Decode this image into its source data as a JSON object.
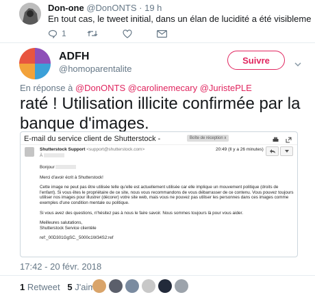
{
  "reply": {
    "name": "Don-one",
    "handle": "@DonONTS",
    "sep": "·",
    "time": "19 h",
    "text": "En tout cas, le tweet initial, dans un élan de lucidité a été visiblement supprimé....",
    "reply_count": "1"
  },
  "tweet": {
    "name": "ADFH",
    "handle": "@homoparentalite",
    "follow_label": "Suivre",
    "in_reply_prefix": "En réponse à",
    "mentions": [
      "@DonONTS",
      "@carolinemecary",
      "@JuristePLE"
    ],
    "text": "raté ! Utilisation illicite confirmée par la banque d'images.",
    "timestamp": "17:42 - 20 févr. 2018",
    "retweets": "1",
    "retweets_label": "Retweet",
    "likes": "5",
    "likes_label": "J'aime"
  },
  "email": {
    "subject": "E-mail du service client de Shutterstock -",
    "badge": "Boîte de réception",
    "badge_close": "x",
    "sender_name": "Shutterstock Support",
    "sender_addr": "<support@shutterstock.com>",
    "to_prefix": "À",
    "time": "20:49 (Il y a 26 minutes)",
    "greeting": "Bonjour",
    "para1": "Merci d'avoir écrit à Shutterstock!",
    "para2": "Cette image ne peut pas être utilisée telle qu'elle est actuellement utilisée car elle implique un mouvement politique (droits de l'enfant). Si vous êtes le propriétaire de ce site, nous vous recommandons de vous débarrasser de ce contenu. Vous pouvez toujours utiliser nos images pour illustrer (décorer) votre site web, mais vous ne pouvez pas utiliser les personnes dans ces images comme exemples d'une condition mentale ou politique.",
    "para3": "Si vous avez des questions, n'hésitez pas à nous le faire savoir. Nous sommes toujours là pour vous aider.",
    "sign1": "Meilleures salutations,",
    "sign2": "Shutterstock Service clientèle",
    "ref": "ref:_00D301GgSC._5000c1W34S2:ref"
  },
  "colors": {
    "accent": "#e0245e",
    "muted": "#657786"
  }
}
